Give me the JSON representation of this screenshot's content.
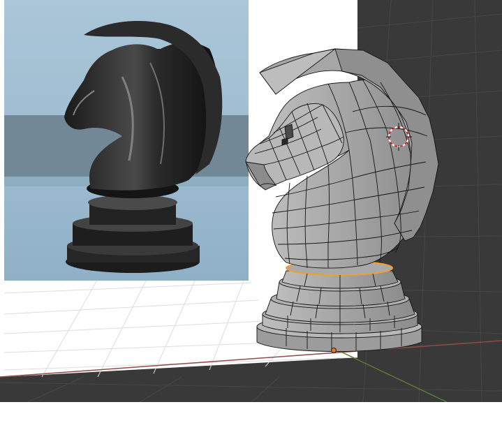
{
  "viewport": {
    "scene_objects": [
      "reference-image-plane",
      "chess-knight-mesh",
      "floor-grid",
      "3d-cursor",
      "object-origin"
    ],
    "colors": {
      "viewport_background": "#393939",
      "grid_line": "#474747",
      "x_axis": "#8f4a4a",
      "y_axis": "#5c7a3a",
      "mesh_fill": "#a2a2a2",
      "mesh_wire": "#111111",
      "selection_edge": "#f0a030",
      "cursor_ring": "#cc2222",
      "origin_dot": "#e07a20",
      "reference_backdrop": "#a8c4d6"
    }
  }
}
